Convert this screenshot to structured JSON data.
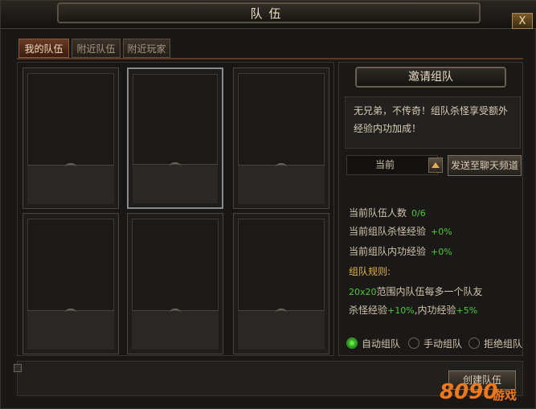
{
  "window": {
    "title": "队伍",
    "close_label": "X"
  },
  "tabs": [
    {
      "label": "我的队伍",
      "active": true
    },
    {
      "label": "附近队伍",
      "active": false
    },
    {
      "label": "附近玩家",
      "active": false
    }
  ],
  "side": {
    "header": "邀请组队",
    "description": "无兄弟，不传奇！组队杀怪享受额外经验内功加成！",
    "channel_value": "当前",
    "send_button": "发送至聊天频道",
    "stats": [
      {
        "label": "当前队伍人数",
        "value": "0/6"
      },
      {
        "label": "当前组队杀怪经验",
        "value": "+0%"
      },
      {
        "label": "当前组队内功经验",
        "value": "+0%"
      }
    ],
    "rules_title": "组队规则:",
    "rule_line1_highlight": "20x20",
    "rule_line1_text": "范围内队伍每多一个队友",
    "rule_line2_a": "杀怪经验",
    "rule_line2_b": "+10%",
    "rule_line2_c": ",内功经验",
    "rule_line2_d": "+5%",
    "radios": [
      {
        "label": "自动组队",
        "checked": true
      },
      {
        "label": "手动组队",
        "checked": false
      },
      {
        "label": "拒绝组队",
        "checked": false
      }
    ]
  },
  "bottom": {
    "create_button": "创建队伍"
  },
  "watermark": {
    "number": "8090",
    "text": "游戏"
  },
  "colors": {
    "accent_green": "#4cc830",
    "rule_gold": "#e0b040",
    "watermark_orange": "#f07818"
  }
}
